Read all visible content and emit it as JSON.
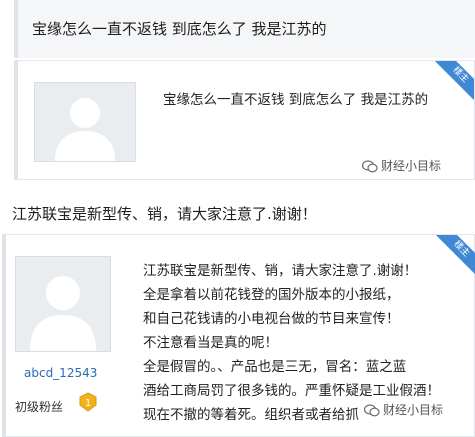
{
  "thread": {
    "title": "宝缘怎么一直不返钱 到底怎么了 我是江苏的"
  },
  "post1": {
    "badge": "楼主",
    "body": "宝缘怎么一直不返钱 到底怎么了 我是江苏的",
    "watermark": "财经小目标"
  },
  "repost": {
    "title": "江苏联宝是新型传、销，请大家注意了.谢谢！"
  },
  "post2": {
    "badge": "楼主",
    "username": "abcd_12543",
    "rank": "初级粉丝",
    "rank_level": "1",
    "lines": [
      "江苏联宝是新型传、销，请大家注意了.谢谢！",
      "全是拿着以前花钱登的国外版本的小报纸，",
      "和自己花钱请的小电视台做的节目来宣传！",
      "不注意看当是真的呢！",
      "全是假冒的。、产品也是三无，冒名：蓝之蓝",
      "酒给工商局罚了很多钱的。严重怀疑是工业假酒！",
      "现在不撤的等着死。组织者或者给抓"
    ],
    "watermark": "财经小目标"
  },
  "colors": {
    "badge": "#3f88d6",
    "username": "#2a6bb5",
    "rank_badge": "#f2b21b"
  }
}
